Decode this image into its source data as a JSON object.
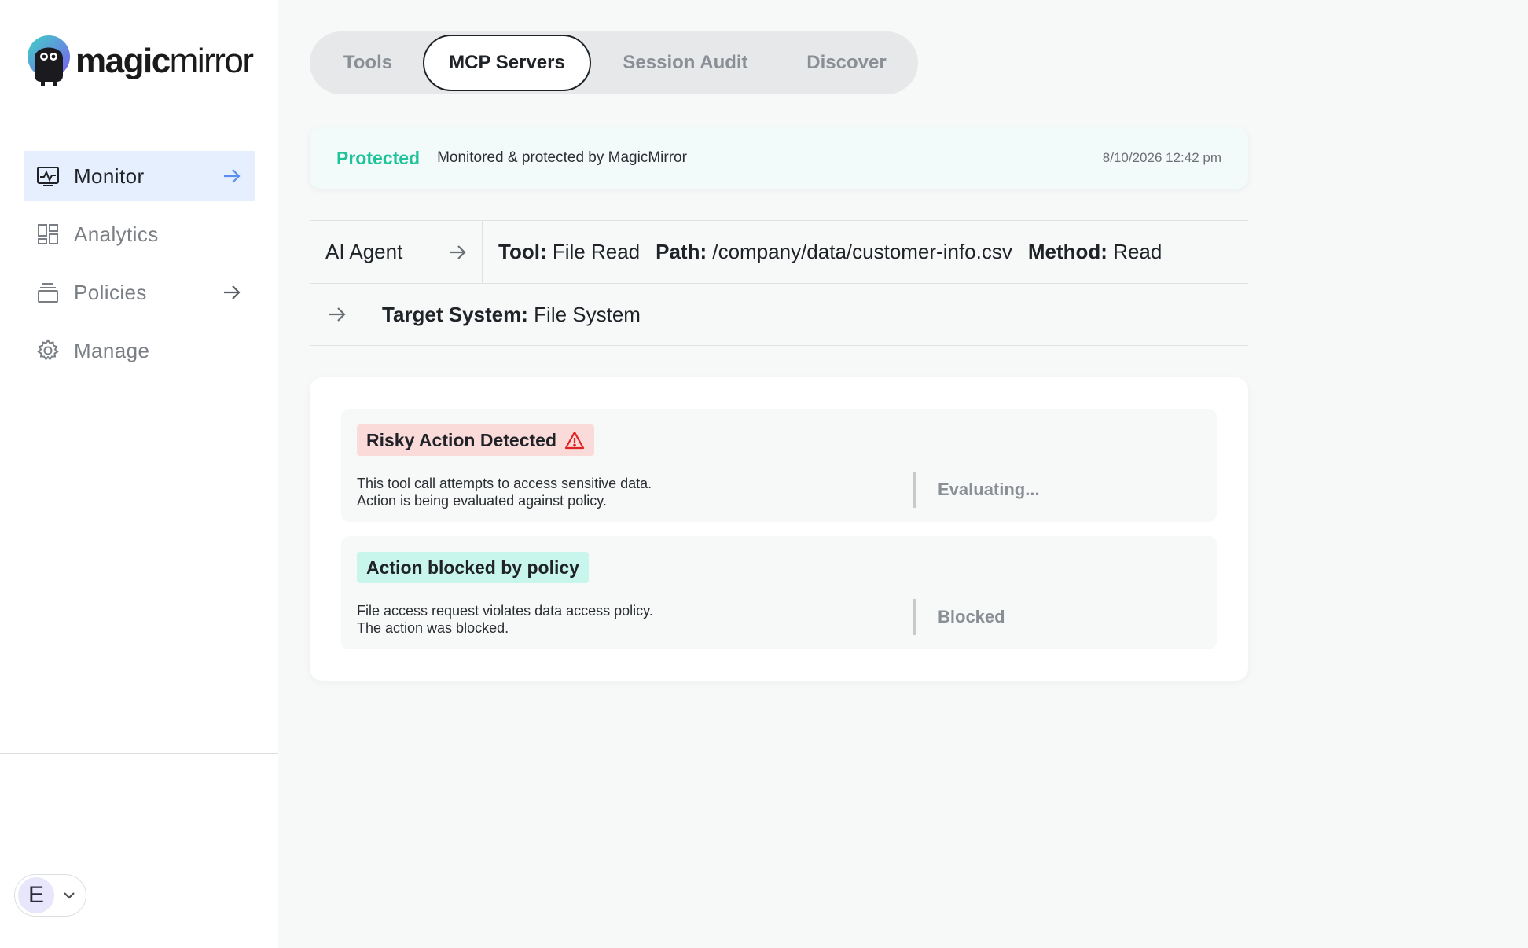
{
  "brand": {
    "logo_bold": "magic",
    "logo_light": "mirror"
  },
  "sidebar": {
    "items": [
      {
        "label": "Monitor",
        "icon": "monitor-pulse-icon",
        "active": true
      },
      {
        "label": "Analytics",
        "icon": "dashboard-grid-icon"
      },
      {
        "label": "Policies",
        "icon": "stack-icon"
      },
      {
        "label": "Manage",
        "icon": "gear-icon"
      }
    ],
    "user_initial": "E"
  },
  "tabs": [
    "Tools",
    "MCP Servers",
    "Session Audit",
    "Discover"
  ],
  "active_tab": "MCP Servers",
  "status": {
    "label": "Protected",
    "text": "Monitored & protected by MagicMirror",
    "timestamp": "8/10/2026 12:42 pm"
  },
  "flow": {
    "agent": "AI Agent",
    "tool_label": "Tool:",
    "tool_value": "File Read",
    "path_label": "Path:",
    "path_value": "/company/data/customer-info.csv",
    "method_label": "Method:",
    "method_value": "Read",
    "target_label": "Target System:",
    "target_value": "File System"
  },
  "events": [
    {
      "title": "Risky Action Detected",
      "line1": "This tool call attempts to access sensitive data.",
      "line2": "Action is being evaluated against policy.",
      "status": "Evaluating..."
    },
    {
      "title": "Action blocked by policy",
      "line1": "File access request violates data access policy.",
      "line2": "The action was blocked.",
      "status": "Blocked"
    }
  ],
  "colors": {
    "accent_green": "#1fc39a",
    "active_nav_bg": "#e5effd",
    "risk_badge": "#fbdada",
    "blocked_badge": "#c8f6ec",
    "warning_red": "#e02424"
  }
}
